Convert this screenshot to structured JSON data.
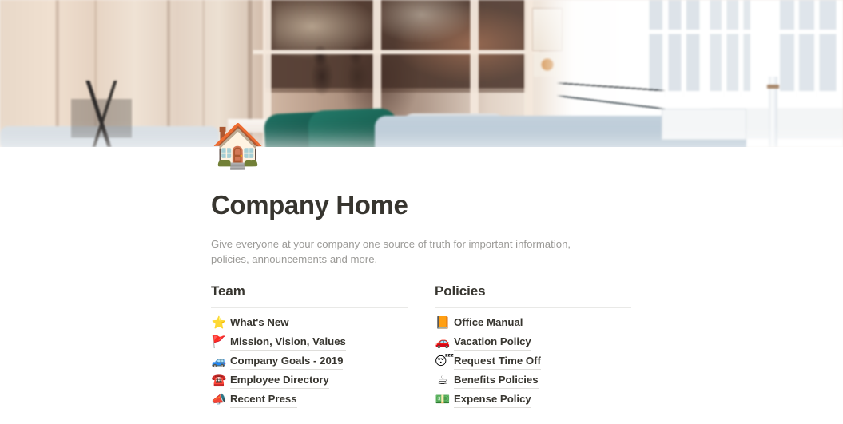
{
  "page": {
    "icon": "🏠",
    "icon_name": "house-emoji",
    "title": "Company Home",
    "description": "Give everyone at your company one source of truth for important information, policies, announcements and more."
  },
  "cover": {
    "alt": "Bright office interior with peach wood panelled glass partition, green chairs and tall white windows",
    "colors": {
      "peach_panel": "#e8d8c8",
      "dark_glass": "#4a342a",
      "chair_green": "#1a6354",
      "sofa_blue": "#b9c9d6",
      "wall_white": "#ffffff"
    }
  },
  "columns": [
    {
      "heading": "Team",
      "links": [
        {
          "emoji": "⭐",
          "emoji_name": "star-icon",
          "label": "What's New"
        },
        {
          "emoji": "🚩",
          "emoji_name": "triangular-flag-icon",
          "label": "Mission, Vision, Values"
        },
        {
          "emoji": "🚙",
          "emoji_name": "blue-car-icon",
          "label": "Company Goals - 2019"
        },
        {
          "emoji": "☎️",
          "emoji_name": "telephone-icon",
          "label": "Employee Directory"
        },
        {
          "emoji": "📣",
          "emoji_name": "megaphone-icon",
          "label": "Recent Press"
        }
      ]
    },
    {
      "heading": "Policies",
      "links": [
        {
          "emoji": "📙",
          "emoji_name": "orange-book-icon",
          "label": "Office Manual"
        },
        {
          "emoji": "🚗",
          "emoji_name": "red-car-icon",
          "label": "Vacation Policy"
        },
        {
          "emoji": "😴",
          "emoji_name": "sleeping-face-icon",
          "label": "Request Time Off"
        },
        {
          "emoji": "☕",
          "emoji_name": "hot-beverage-icon",
          "label": "Benefits Policies"
        },
        {
          "emoji": "💵",
          "emoji_name": "dollar-banknote-icon",
          "label": "Expense Policy"
        }
      ]
    }
  ],
  "theme": {
    "text_primary": "#37352f",
    "text_secondary": "#9b9a97",
    "divider": "#e9e9e7",
    "link_underline": "#dfdedb",
    "background": "#ffffff"
  }
}
